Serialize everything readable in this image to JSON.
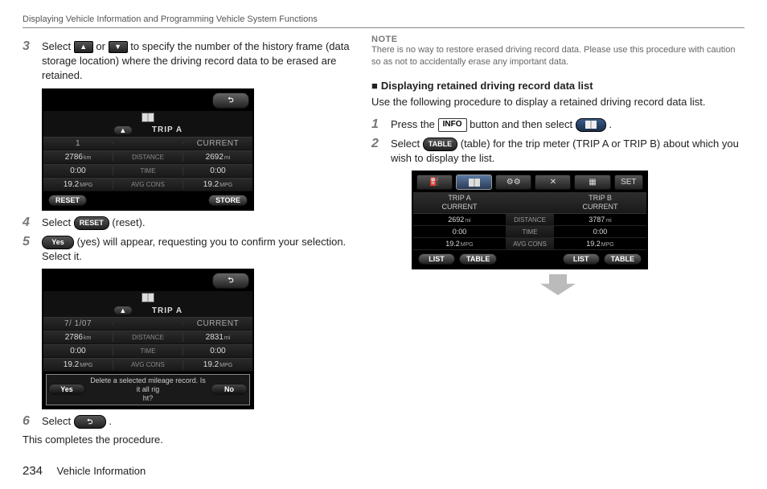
{
  "header": "Displaying Vehicle Information and Programming Vehicle System Functions",
  "buttons": {
    "info": "INFO",
    "reset": "RESET",
    "yes": "Yes",
    "no": "No",
    "table": "TABLE",
    "store": "STORE",
    "list": "LIST",
    "set": "SET",
    "back": "⮌",
    "tri_up": "▲",
    "tri_down": "▼"
  },
  "left": {
    "step3": {
      "text_a": "Select",
      "text_b": "or",
      "text_c": "to specify the number of the history frame (data storage location) where the driving record data to be erased are retained."
    },
    "ss1": {
      "trip": "TRIP A",
      "col1_head": "1",
      "col3_head": "CURRENT",
      "r1_a": "2786",
      "r1_a_u": "km",
      "r1_b": "DISTANCE",
      "r1_c": "2692",
      "r1_c_u": "mi",
      "r2_a": "0:00",
      "r2_b": "TIME",
      "r2_c": "0:00",
      "r3_a": "19.2",
      "r3_a_u": "MPG",
      "r3_b": "AVG CONS",
      "r3_c": "19.2",
      "r3_c_u": "MPG"
    },
    "step4_a": "Select",
    "step4_b": "(reset).",
    "step5_a": "(yes) will appear, requesting you to confirm your selection. Select it.",
    "ss2": {
      "trip": "TRIP A",
      "col1_head": "7/ 1/07",
      "col3_head": "CURRENT",
      "r1_a": "2786",
      "r1_a_u": "km",
      "r1_b": "DISTANCE",
      "r1_c": "2831",
      "r1_c_u": "mi",
      "r2_a": "0:00",
      "r2_b": "TIME",
      "r2_c": "0:00",
      "r3_a": "19.2",
      "r3_a_u": "MPG",
      "r3_b": "AVG CONS",
      "r3_c": "19.2",
      "r3_c_u": "MPG",
      "dialog": "Delete a selected mileage record. Is it all rig\nht?"
    },
    "step6": "Select",
    "complete": "This completes the procedure."
  },
  "right": {
    "note_head": "NOTE",
    "note_body": "There is no way to restore erased driving record data. Please use this procedure with caution so as not to accidentally erase any important data.",
    "subhead": "Displaying retained driving record data list",
    "para": "Use the following procedure to display a retained driving record data list.",
    "step1_a": "Press the",
    "step1_b": "button and then select",
    "step1_c": ".",
    "step2_a": "Select",
    "step2_b": "(table) for the trip meter (TRIP A or TRIP B) about which you wish to display the list.",
    "ss3": {
      "tripA_head": "TRIP A",
      "tripB_head": "TRIP B",
      "current": "CURRENT",
      "r1_lab": "DISTANCE",
      "a1": "2692",
      "a1u": "mi",
      "b1": "3787",
      "b1u": "mi",
      "r2_lab": "TIME",
      "a2": "0:00",
      "b2": "0:00",
      "r3_lab": "AVG CONS",
      "a3": "19.2",
      "a3u": "MPG",
      "b3": "19.2",
      "b3u": "MPG"
    }
  },
  "footer": {
    "pagenum": "234",
    "section": "Vehicle Information"
  }
}
